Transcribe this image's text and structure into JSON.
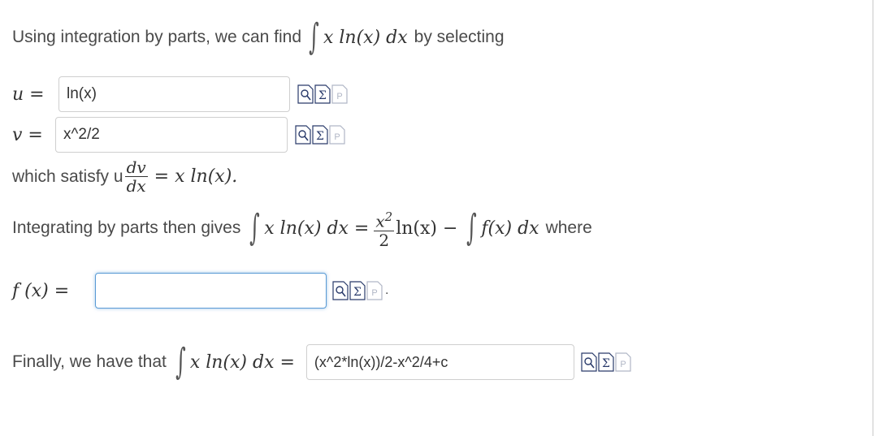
{
  "intro": {
    "prefix": "Using integration by parts, we can find",
    "integrand": "x ln(x) dx",
    "suffix": "by selecting"
  },
  "u_row": {
    "label": "u =",
    "value": "ln(x)"
  },
  "v_row": {
    "label": "v =",
    "value": "x^2/2"
  },
  "satisfy": {
    "prefix": "which satisfy u",
    "frac_num": "dv",
    "frac_den": "dx",
    "rhs": "= x ln(x)."
  },
  "integrating": {
    "prefix": "Integrating by parts then gives",
    "lhs": "x ln(x) dx =",
    "frac_num": "x",
    "frac_num_sup": "2",
    "frac_den": "2",
    "mid": "ln(x) −",
    "rhs": "f(x) dx",
    "suffix": "where"
  },
  "f_row": {
    "label": "f (x) =",
    "value": "",
    "trailing": "."
  },
  "finally": {
    "prefix": "Finally, we have that",
    "expr": "x ln(x) dx =",
    "value": "(x^2*ln(x))/2-x^2/4+c"
  },
  "tool_icons": [
    "preview-icon",
    "equation-editor-icon",
    "paste-icon"
  ]
}
